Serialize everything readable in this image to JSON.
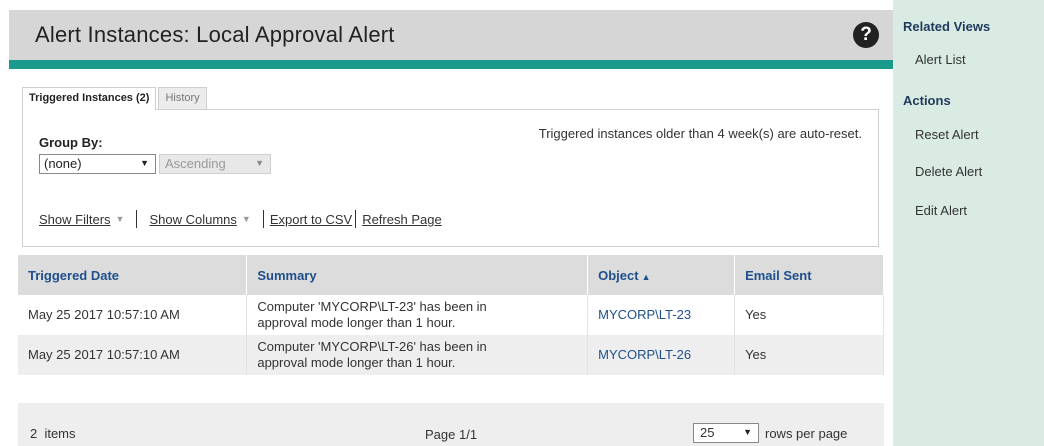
{
  "header": {
    "title": "Alert Instances: Local Approval Alert",
    "help_icon": "question-circle-icon"
  },
  "tabs": [
    {
      "label": "Triggered Instances (2)",
      "active": true
    },
    {
      "label": "History",
      "active": false
    }
  ],
  "group_by": {
    "label": "Group By:",
    "value": "(none)",
    "order_value": "Ascending"
  },
  "autoreset_note": "Triggered instances older than 4 week(s) are auto-reset.",
  "toolbar": {
    "show_filters": "Show Filters",
    "show_columns": "Show Columns",
    "export_csv": "Export to CSV",
    "refresh_page": "Refresh Page"
  },
  "table": {
    "columns": [
      "Triggered Date",
      "Summary",
      "Object",
      "Email Sent"
    ],
    "sorted_column": "Object",
    "rows": [
      {
        "triggered_date": "May 25 2017 10:57:10 AM",
        "summary_line1": "Computer 'MYCORP\\LT-23' has been in",
        "summary_line2": "approval mode longer than 1 hour.",
        "object": "MYCORP\\LT-23",
        "email_sent": "Yes"
      },
      {
        "triggered_date": "May 25 2017 10:57:10 AM",
        "summary_line1": "Computer 'MYCORP\\LT-26' has been in",
        "summary_line2": "approval mode longer than 1 hour.",
        "object": "MYCORP\\LT-26",
        "email_sent": "Yes"
      }
    ]
  },
  "footer": {
    "item_count": "2  items",
    "page_info": "Page 1/1",
    "rows_per_page_value": "25",
    "rows_per_page_label": "rows per page"
  },
  "sidebar": {
    "related_views_heading": "Related Views",
    "related_views": [
      "Alert List"
    ],
    "actions_heading": "Actions",
    "actions": [
      "Reset Alert",
      "Delete Alert",
      "Edit Alert"
    ]
  },
  "colors": {
    "header_bg": "#d6d6d6",
    "accent_teal": "#1a9a8a",
    "sidebar_bg": "#d9ebe3",
    "link_blue": "#1f4f8c"
  }
}
